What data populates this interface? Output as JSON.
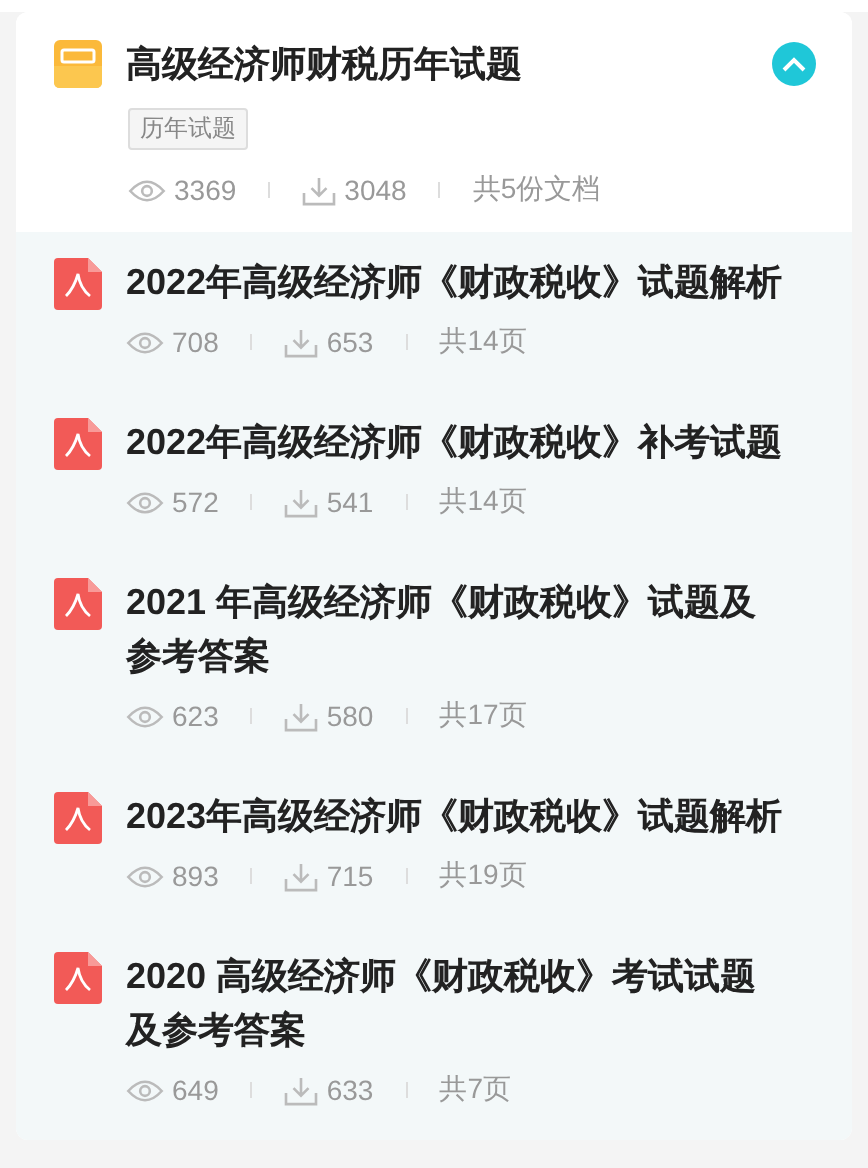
{
  "header": {
    "title": "高级经济师财税历年试题",
    "expanded": true,
    "tag": "历年试题",
    "views": "3369",
    "downloads": "3048",
    "count": "共5份文档"
  },
  "documents": [
    {
      "title": "2022年高级经济师《财政税收》试题解析",
      "views": "708",
      "downloads": "653",
      "pages": "共14页"
    },
    {
      "title": "2022年高级经济师《财政税收》补考试题",
      "views": "572",
      "downloads": "541",
      "pages": "共14页"
    },
    {
      "title": "2021 年高级经济师《财政税收》试题及参考答案",
      "views": "623",
      "downloads": "580",
      "pages": "共17页"
    },
    {
      "title": "2023年高级经济师《财政税收》试题解析",
      "views": "893",
      "downloads": "715",
      "pages": "共19页"
    },
    {
      "title": "2020 高级经济师《财政税收》考试试题及参考答案",
      "views": "649",
      "downloads": "633",
      "pages": "共7页"
    }
  ]
}
